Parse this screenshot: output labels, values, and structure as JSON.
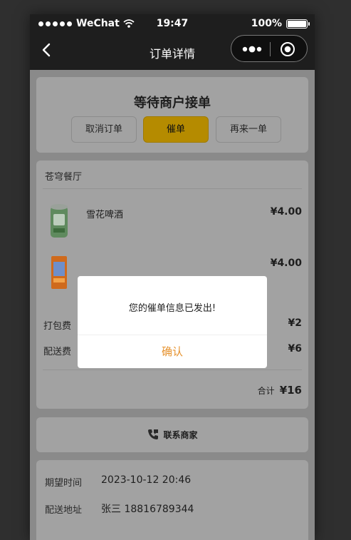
{
  "status_bar": {
    "carrier": "WeChat",
    "time": "19:47",
    "battery": "100%"
  },
  "nav": {
    "title": "订单详情",
    "back_icon": "chevron-left-icon",
    "more_icon": "more-dots-icon",
    "close_icon": "target-circle-icon"
  },
  "order_status": {
    "title": "等待商户接单",
    "buttons": {
      "cancel": "取消订单",
      "urge": "催单",
      "reorder": "再来一单"
    }
  },
  "order": {
    "shop_name": "苍穹餐厅",
    "items": [
      {
        "name": "雪花啤酒",
        "price": "¥4.00",
        "image": "beer-can-image"
      },
      {
        "name": "",
        "price": "¥4.00",
        "image": "orange-drink-image"
      }
    ],
    "fees": [
      {
        "label": "打包费",
        "value": "¥2"
      },
      {
        "label": "配送费",
        "value": "¥6"
      }
    ],
    "total_label": "合计",
    "total_value": "¥16"
  },
  "contact": {
    "label": "联系商家",
    "icon": "phone-icon"
  },
  "info": {
    "expected_time_label": "期望时间",
    "expected_time_value": "2023-10-12 20:46",
    "address_label": "配送地址",
    "address_value": "张三  18816789344"
  },
  "dialog": {
    "message": "您的催单信息已发出!",
    "confirm": "确认"
  },
  "colors": {
    "accent": "#e6922e",
    "urge_button": "#b58b00",
    "nav_bg": "#1e1e1e"
  }
}
